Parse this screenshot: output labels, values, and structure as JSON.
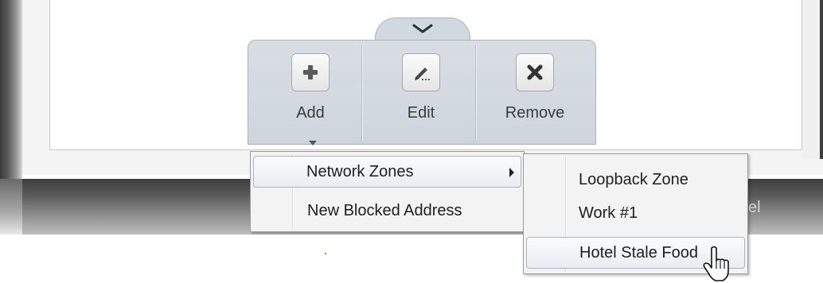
{
  "toolbar": {
    "buttons": [
      {
        "label": "Add",
        "icon": "plus-icon"
      },
      {
        "label": "Edit",
        "icon": "pencil-icon"
      },
      {
        "label": "Remove",
        "icon": "x-icon"
      }
    ]
  },
  "context_menu": {
    "items": [
      {
        "label": "Network Zones",
        "has_submenu": true,
        "highlighted": true
      },
      {
        "label": "New Blocked Address",
        "has_submenu": false,
        "highlighted": false
      }
    ]
  },
  "submenu": {
    "items": [
      {
        "label": "Loopback Zone",
        "highlighted": false
      },
      {
        "label": "Work #1",
        "highlighted": false
      },
      {
        "label": "Hotel Stale Food",
        "highlighted": true
      }
    ]
  },
  "footer": {
    "partial_cancel_label": "cel"
  },
  "colors": {
    "toolbar_bg": "#d2d8e0",
    "menu_bg": "#f3f3f3",
    "highlight_border": "#a9b4c2"
  }
}
